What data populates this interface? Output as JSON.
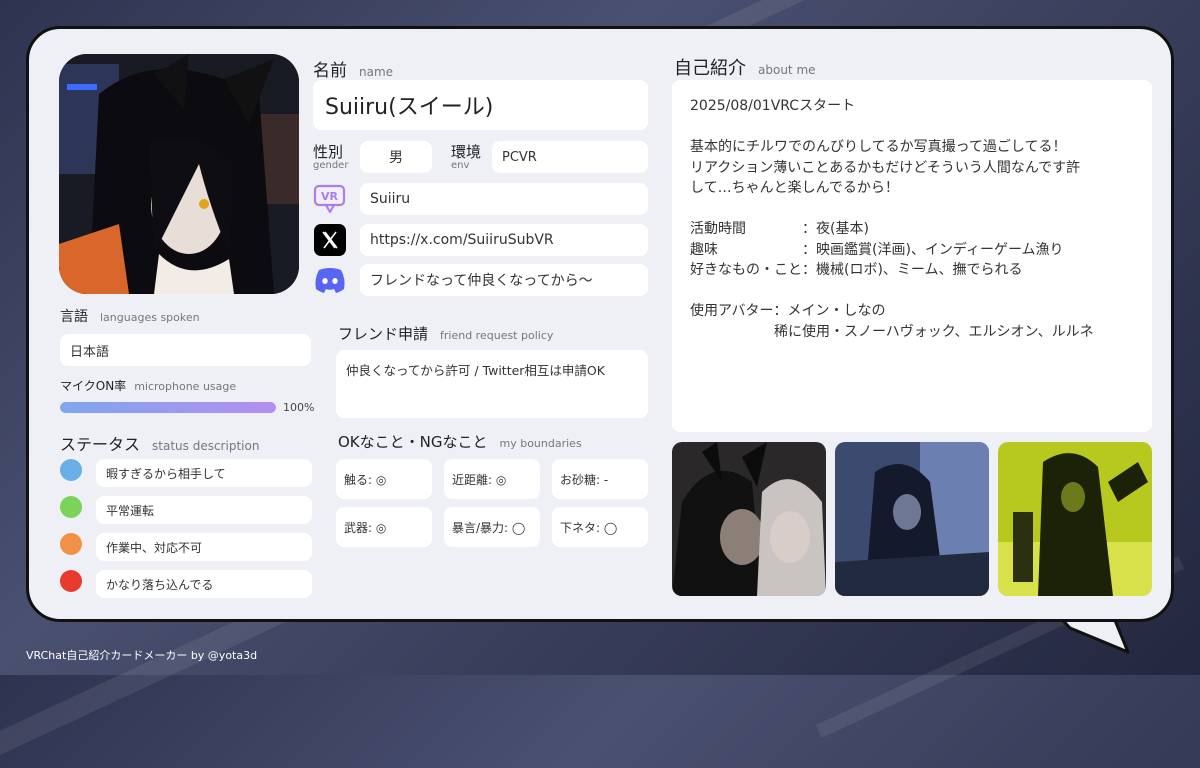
{
  "profile": {
    "name_label": "名前",
    "name_label_en": "name",
    "name_value": "Suiiru(スイール)",
    "gender_label": "性別",
    "gender_label_en": "gender",
    "gender_value": "男",
    "env_label": "環境",
    "env_label_en": "env",
    "env_value": "PCVR",
    "vrchat_value": "Suiiru",
    "x_value": "https://x.com/SuiiruSubVR",
    "discord_value": "フレンドなって仲良くなってから〜"
  },
  "languages": {
    "label": "言語",
    "label_en": "languages spoken",
    "value": "日本語"
  },
  "mic": {
    "label": "マイクON率",
    "label_en": "microphone usage",
    "percent": 100,
    "percent_text": "100%"
  },
  "status": {
    "label": "ステータス",
    "label_en": "status description",
    "items": [
      {
        "color": "#6aaee8",
        "text": "暇すぎるから相手して"
      },
      {
        "color": "#7dd35a",
        "text": "平常運転"
      },
      {
        "color": "#f0914a",
        "text": "作業中、対応不可"
      },
      {
        "color": "#e83a2e",
        "text": "かなり落ち込んでる"
      }
    ]
  },
  "friend": {
    "label": "フレンド申請",
    "label_en": "friend request policy",
    "value": "仲良くなってから許可 / Twitter相互は申請OK"
  },
  "boundaries": {
    "label": "OKなこと・NGなこと",
    "label_en": "my boundaries",
    "items": [
      "触る: ◎",
      "近距離: ◎",
      "お砂糖: -",
      "武器: ◎",
      "暴言/暴力: ◯",
      "下ネタ: ◯"
    ]
  },
  "about": {
    "label": "自己紹介",
    "label_en": "about me",
    "text": "2025/08/01VRCスタート\n\n基本的にチルワでのんびりしてるか写真撮って過ごしてる！\nリアクション薄いことあるかもだけどそういう人間なんです許\nして…ちゃんと楽しんでるから！\n\n活動時間　　　　：夜(基本)\n趣味　　　　　　：映画鑑賞(洋画)、インディーゲーム漁り\n好きなもの・こと：機械(ロボ)、ミーム、撫でられる\n\n使用アバター：メイン・しなの\n　　　　　　稀に使用・スノーハヴォック、エルシオン、ルルネ"
  },
  "footer": {
    "credit": "VRChat自己紹介カードメーカー by @yota3d"
  },
  "icons": {
    "vrchat": "vrchat-icon",
    "x": "x-logo-icon",
    "discord": "discord-icon"
  },
  "colors": {
    "mic_bar_start": "#7fa6ee",
    "mic_bar_end": "#b48ef0",
    "vrchat_purple": "#b07de8",
    "discord_blurple": "#5865f2"
  }
}
